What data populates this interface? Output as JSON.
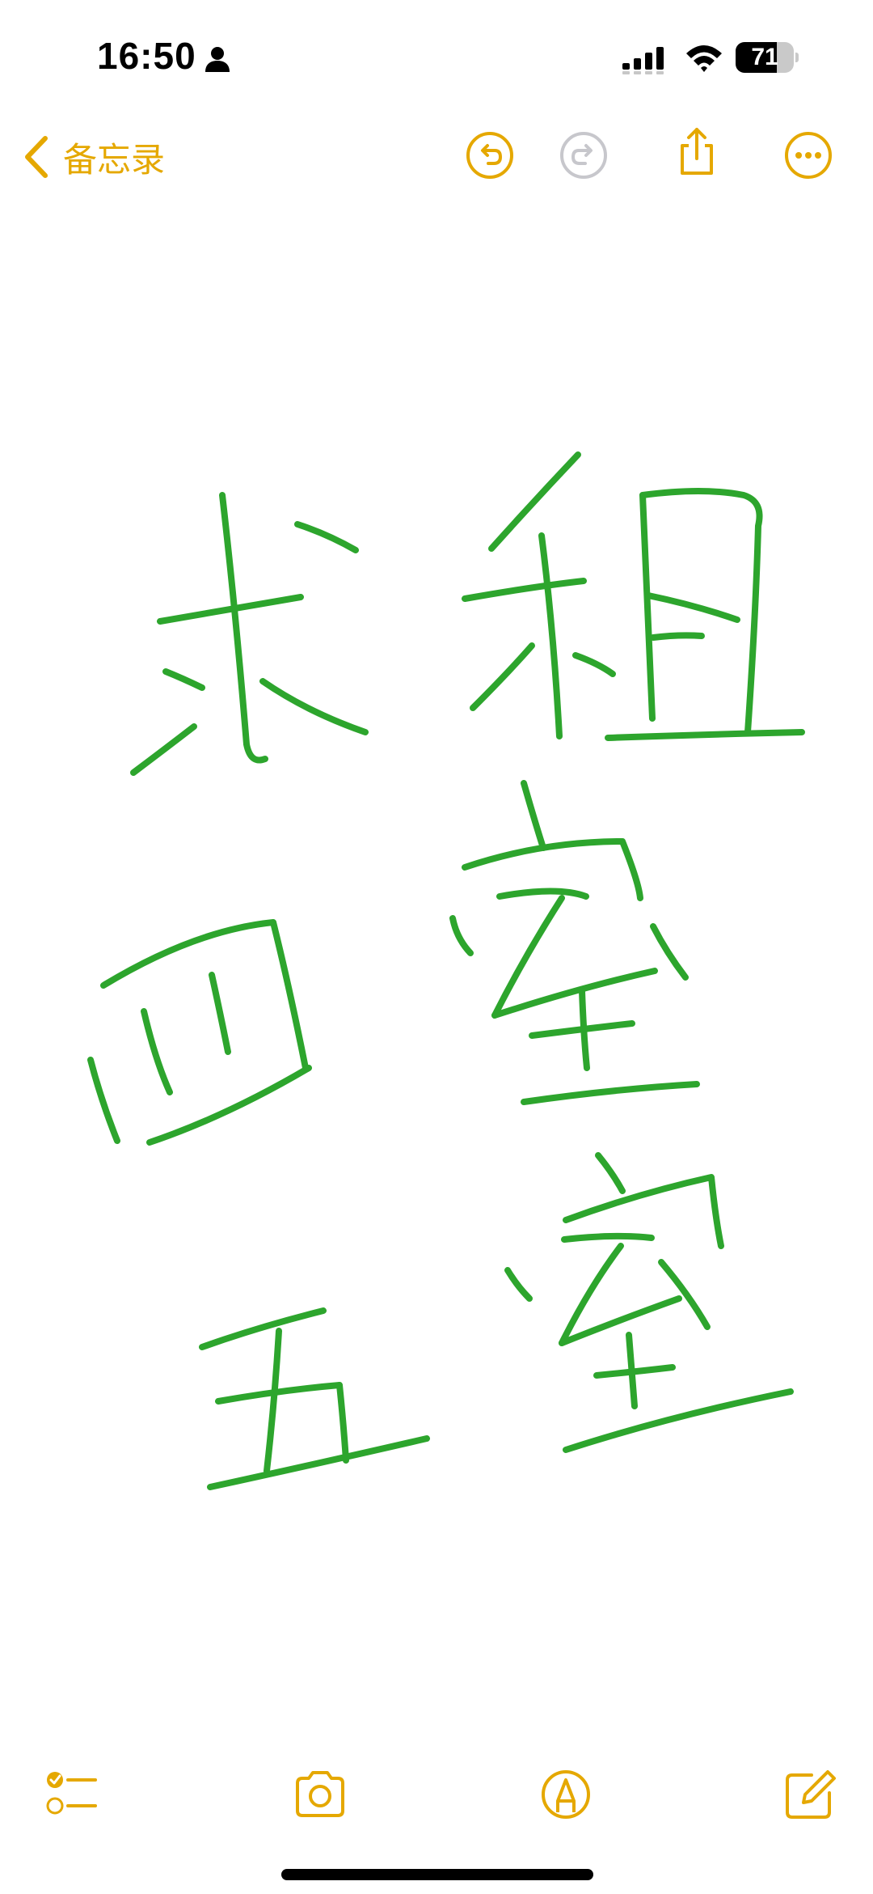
{
  "status_bar": {
    "time": "16:50",
    "battery_level": "71",
    "battery_fraction": 0.71,
    "icons": [
      "person-icon",
      "cellular-signal-icon",
      "wifi-icon",
      "battery-icon"
    ]
  },
  "nav": {
    "back_label": "备忘录",
    "icons": [
      "chevron-left-icon",
      "undo-icon",
      "redo-icon",
      "share-icon",
      "more-icon"
    ],
    "accent_color": "#E5A800",
    "disabled_color": "#C7C7CC"
  },
  "canvas": {
    "ink_color": "#2DA52D",
    "handwriting": [
      "求",
      "租",
      "四",
      "室",
      "五",
      "室"
    ]
  },
  "toolbar": {
    "icons": [
      "checklist-icon",
      "camera-icon",
      "markup-icon",
      "compose-icon"
    ]
  }
}
